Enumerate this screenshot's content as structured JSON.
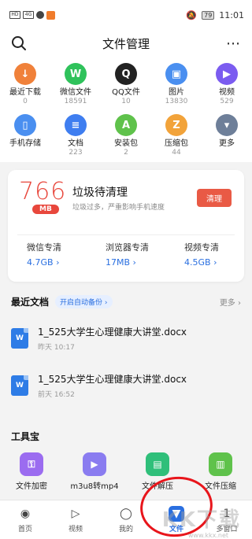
{
  "status_bar": {
    "network_left": "HD",
    "signal": "4G",
    "battery": "79",
    "time": "11:01"
  },
  "header": {
    "title": "文件管理"
  },
  "categories": [
    {
      "label": "最近下载",
      "count": "0",
      "color": "#f0813a",
      "glyph": "↓",
      "icon": "download-icon"
    },
    {
      "label": "微信文件",
      "count": "18591",
      "color": "#2fc25b",
      "glyph": "W",
      "icon": "wechat-icon"
    },
    {
      "label": "QQ文件",
      "count": "10",
      "color": "#222222",
      "glyph": "Q",
      "icon": "qq-icon"
    },
    {
      "label": "图片",
      "count": "13830",
      "color": "#4a8ff0",
      "glyph": "▣",
      "icon": "image-icon"
    },
    {
      "label": "视频",
      "count": "529",
      "color": "#7b5cf0",
      "glyph": "▶",
      "icon": "video-icon"
    },
    {
      "label": "手机存储",
      "count": "",
      "color": "#4a8ff0",
      "glyph": "▯",
      "icon": "phone-storage-icon"
    },
    {
      "label": "文档",
      "count": "223",
      "color": "#3f7ef0",
      "glyph": "≡",
      "icon": "document-icon"
    },
    {
      "label": "安装包",
      "count": "2",
      "color": "#5fc24b",
      "glyph": "A",
      "icon": "apk-icon"
    },
    {
      "label": "压缩包",
      "count": "44",
      "color": "#f2a33a",
      "glyph": "Z",
      "icon": "archive-icon"
    },
    {
      "label": "更多",
      "count": "",
      "color": "#6e7f99",
      "glyph": "▾",
      "icon": "more-icon"
    }
  ],
  "cleanup": {
    "amount": "766",
    "unit": "MB",
    "title": "垃圾待清理",
    "subtitle": "垃圾过多，严重影响手机速度",
    "button": "清理",
    "items": [
      {
        "name": "微信专清",
        "size": "4.7GB"
      },
      {
        "name": "浏览器专清",
        "size": "17MB"
      },
      {
        "name": "视频专清",
        "size": "4.5GB"
      }
    ]
  },
  "recent_docs": {
    "title": "最近文档",
    "backup_label": "开启自动备份",
    "more_label": "更多",
    "items": [
      {
        "name": "1_525大学生心理健康大讲堂.docx",
        "time": "昨天 10:17",
        "icon_text": "W"
      },
      {
        "name": "1_525大学生心理健康大讲堂.docx",
        "time": "前天 16:52",
        "icon_text": "W"
      }
    ]
  },
  "tools": {
    "title": "工具宝",
    "items": [
      {
        "label": "文件加密",
        "color": "#9b6cf0",
        "glyph": "⚿",
        "icon": "lock-icon"
      },
      {
        "label": "m3u8转mp4",
        "color": "#8a7cf0",
        "glyph": "▶",
        "icon": "video-convert-icon"
      },
      {
        "label": "文件解压",
        "color": "#2fbf7a",
        "glyph": "▤",
        "icon": "unzip-icon"
      },
      {
        "label": "文件压缩",
        "color": "#5fc24b",
        "glyph": "▥",
        "icon": "compress-icon"
      }
    ]
  },
  "bottom_nav": [
    {
      "label": "首页",
      "glyph": "◉",
      "icon": "home-icon",
      "active": false
    },
    {
      "label": "视频",
      "glyph": "▷",
      "icon": "video-tab-icon",
      "active": false
    },
    {
      "label": "我的",
      "glyph": "◯",
      "icon": "profile-icon",
      "active": false
    },
    {
      "label": "文件",
      "glyph": "▼",
      "icon": "file-tab-icon",
      "active": true
    },
    {
      "label": "多窗口",
      "glyph": "1",
      "icon": "multi-window-icon",
      "active": false
    }
  ],
  "watermark": {
    "text": "KK下载",
    "url": "www.kkx.net"
  }
}
